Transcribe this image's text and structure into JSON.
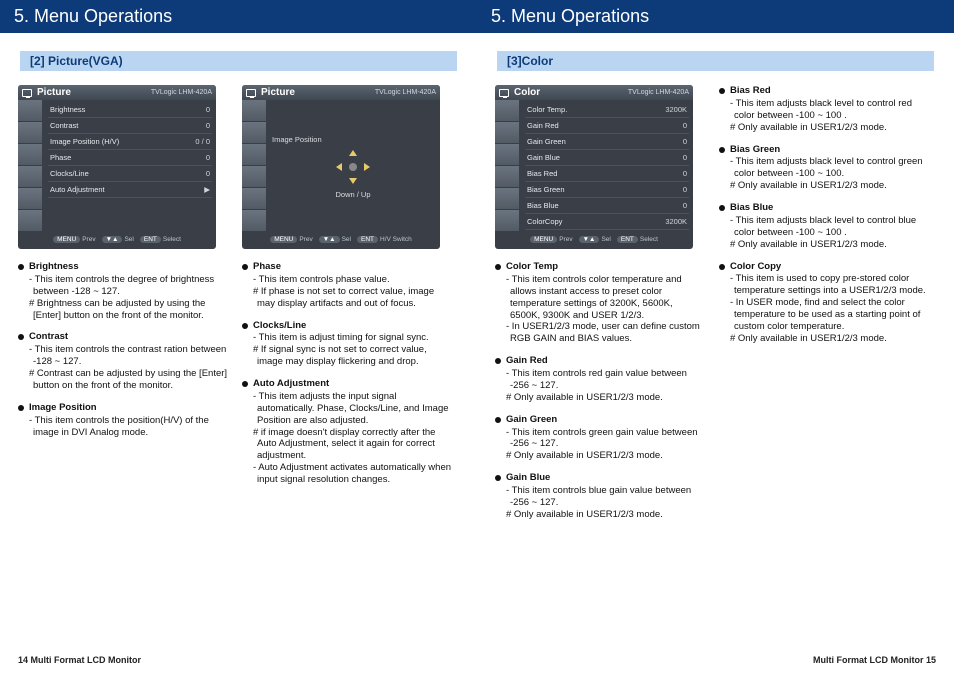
{
  "pages": {
    "left": {
      "title": "5. Menu Operations",
      "section": "[2] Picture(VGA)",
      "footer": "14  Multi Format LCD Monitor"
    },
    "right": {
      "title": "5. Menu Operations",
      "section": "[3]Color",
      "footer": "Multi Format LCD Monitor   15"
    }
  },
  "osd": {
    "picture1": {
      "title": "Picture",
      "brand": "TVLogic  LHM-420A",
      "rows": [
        {
          "label": "Brightness",
          "val": "0"
        },
        {
          "label": "Contrast",
          "val": "0"
        },
        {
          "label": "Image Position    (H/V)",
          "val": "0 / 0"
        },
        {
          "label": "Phase",
          "val": "0"
        },
        {
          "label": "Clocks/Line",
          "val": "0"
        },
        {
          "label": "Auto Adjustment",
          "val": "▶"
        }
      ],
      "footer": {
        "a": "Prev",
        "b": "Sel",
        "c": "Select"
      }
    },
    "picture2": {
      "title": "Picture",
      "brand": "TVLogic  LHM-420A",
      "label": "Image Position",
      "nav": "Down / Up",
      "footer": {
        "a": "Prev",
        "b": "Sel",
        "c": "H/V Switch"
      }
    },
    "color": {
      "title": "Color",
      "brand": "TVLogic  LHM-420A",
      "rows": [
        {
          "label": "Color Temp.",
          "val": "3200K"
        },
        {
          "label": "Gain Red",
          "val": "0"
        },
        {
          "label": "Gain Green",
          "val": "0"
        },
        {
          "label": "Gain Blue",
          "val": "0"
        },
        {
          "label": "Bias Red",
          "val": "0"
        },
        {
          "label": "Bias Green",
          "val": "0"
        },
        {
          "label": "Bias Blue",
          "val": "0"
        },
        {
          "label": "ColorCopy",
          "val": "3200K"
        }
      ],
      "footer": {
        "a": "Prev",
        "b": "Sel",
        "c": "Select"
      }
    }
  },
  "desc": {
    "left_col1": [
      {
        "name": "Brightness",
        "lines": [
          "- This item controls the degree of brightness between -128 ~ 127.",
          "  # Brightness can be adjusted by using the [Enter] button on the front of the monitor."
        ]
      },
      {
        "name": "Contrast",
        "lines": [
          "- This item controls the contrast ration between -128 ~ 127.",
          "  # Contrast can be adjusted by using the [Enter] button on the front of the monitor."
        ]
      },
      {
        "name": "Image Position",
        "lines": [
          "- This item controls the position(H/V) of the image in DVI Analog mode."
        ]
      }
    ],
    "left_col2": [
      {
        "name": "Phase",
        "lines": [
          "- This item controls phase value.",
          "  # If phase is not set to correct value, image may display artifacts and out of focus."
        ]
      },
      {
        "name": "Clocks/Line",
        "lines": [
          "- This item is adjust timing for signal sync.",
          "  # If signal sync is not set to correct value, image may display flickering and drop."
        ]
      },
      {
        "name": "Auto Adjustment",
        "lines": [
          "- This item adjusts the input signal automatically. Phase, Clocks/Line, and Image Position are also adjusted.",
          "  # if image doesn't display correctly after the Auto Adjustment, select it again for correct adjustment.",
          "- Auto Adjustment activates automatically when input signal resolution changes."
        ]
      }
    ],
    "right_col1": [
      {
        "name": "Color Temp",
        "lines": [
          "- This item controls color temperature and allows instant access to preset color temperature settings of 3200K, 5600K, 6500K, 9300K and USER 1/2/3.",
          "- In USER1/2/3 mode, user can define custom RGB GAIN and BIAS values."
        ]
      },
      {
        "name": "Gain Red",
        "lines": [
          "- This item controls red gain value between -256 ~ 127.",
          "  # Only available in USER1/2/3 mode."
        ]
      },
      {
        "name": "Gain Green",
        "lines": [
          "- This item controls green gain value between -256 ~ 127.",
          "  # Only available in USER1/2/3 mode."
        ]
      },
      {
        "name": "Gain Blue",
        "lines": [
          "- This item controls blue gain value between -256 ~ 127.",
          "  # Only available in USER1/2/3 mode."
        ]
      }
    ],
    "right_col2": [
      {
        "name": "Bias Red",
        "lines": [
          "- This item adjusts black level to control red color between -100 ~ 100 .",
          "  # Only available in USER1/2/3 mode."
        ]
      },
      {
        "name": "Bias Green",
        "lines": [
          "- This item adjusts black level to control green color between -100 ~ 100.",
          "  # Only available in USER1/2/3 mode."
        ]
      },
      {
        "name": "Bias Blue",
        "lines": [
          "- This item adjusts black level to control blue color between -100 ~ 100 .",
          "  # Only available in USER1/2/3 mode."
        ]
      },
      {
        "name": "Color Copy",
        "lines": [
          "- This item is used to copy pre-stored color temperature settings into a USER1/2/3 mode.",
          "- In USER mode, find and select the color temperature to be used as a starting point of custom color temperature.",
          "  # Only available in USER1/2/3 mode."
        ]
      }
    ]
  }
}
